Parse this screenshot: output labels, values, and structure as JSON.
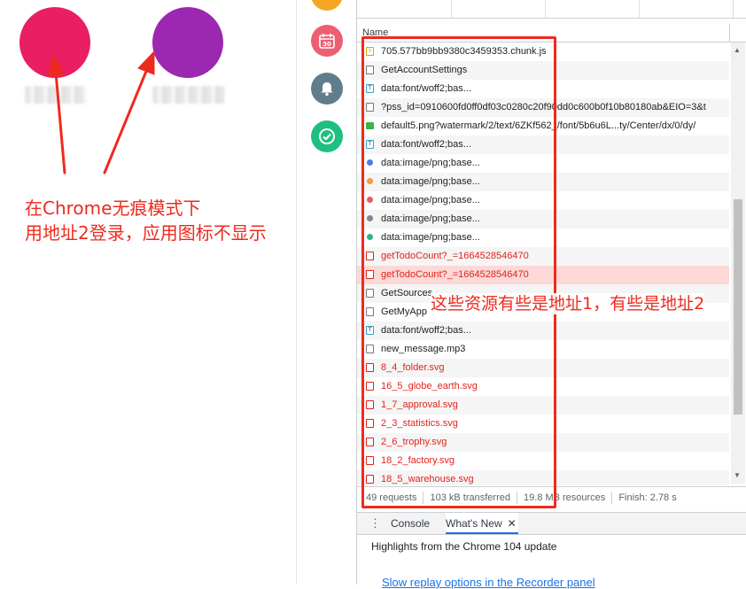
{
  "left": {
    "avatars": [
      {
        "color": "#e91e63"
      },
      {
        "color": "#9c27b0"
      }
    ],
    "annotation_lines": [
      "在Chrome无痕模式下",
      "用地址2登录，应用图标不显示"
    ]
  },
  "app_icons": [
    {
      "name": "top-icon",
      "color": "#f5a623",
      "glyph": ""
    },
    {
      "name": "calendar-icon",
      "color": "#ec5f73",
      "glyph": "30"
    },
    {
      "name": "bell-icon",
      "color": "#607d8b",
      "glyph": ""
    },
    {
      "name": "check-icon",
      "color": "#1fbf7f",
      "glyph": ""
    }
  ],
  "devtools": {
    "column_header": "Name",
    "requests": [
      {
        "name": "705.577bb9bb9380c3459353.chunk.js",
        "icon": "js",
        "error": false
      },
      {
        "name": "GetAccountSettings",
        "icon": "doc",
        "error": false
      },
      {
        "name": "data:font/woff2;bas...",
        "icon": "font",
        "error": false
      },
      {
        "name": "?pss_id=0910600fd0ff0df03c0280c20f90dd0c600b0f10b80180ab&EIO=3&t",
        "icon": "doc",
        "error": false
      },
      {
        "name": "default5.png?watermark/2/text/6ZKf562_/font/5b6u6L...ty/Center/dx/0/dy/",
        "icon": "img-green",
        "error": false
      },
      {
        "name": "data:font/woff2;bas...",
        "icon": "font",
        "error": false
      },
      {
        "name": "data:image/png;base...",
        "icon": "dot blue",
        "error": false
      },
      {
        "name": "data:image/png;base...",
        "icon": "dot orange",
        "error": false
      },
      {
        "name": "data:image/png;base...",
        "icon": "dot red",
        "error": false
      },
      {
        "name": "data:image/png;base...",
        "icon": "dot gray",
        "error": false
      },
      {
        "name": "data:image/png;base...",
        "icon": "dot green",
        "error": false
      },
      {
        "name": "getTodoCount?_=1664528546470",
        "icon": "err",
        "error": true
      },
      {
        "name": "getTodoCount?_=1664528546470",
        "icon": "err",
        "error": true,
        "selected": true
      },
      {
        "name": "GetSources",
        "icon": "doc",
        "error": false
      },
      {
        "name": "GetMyApp",
        "icon": "doc",
        "error": false
      },
      {
        "name": "data:font/woff2;bas...",
        "icon": "font",
        "error": false
      },
      {
        "name": "new_message.mp3",
        "icon": "doc",
        "error": false
      },
      {
        "name": "8_4_folder.svg",
        "icon": "err",
        "error": true
      },
      {
        "name": "16_5_globe_earth.svg",
        "icon": "err",
        "error": true
      },
      {
        "name": "1_7_approval.svg",
        "icon": "err",
        "error": true
      },
      {
        "name": "2_3_statistics.svg",
        "icon": "err",
        "error": true
      },
      {
        "name": "2_6_trophy.svg",
        "icon": "err",
        "error": true
      },
      {
        "name": "18_2_factory.svg",
        "icon": "err",
        "error": true
      },
      {
        "name": "18_5_warehouse.svg",
        "icon": "err",
        "error": true
      }
    ],
    "status": {
      "requests": "49 requests",
      "transferred": "103 kB transferred",
      "resources": "19.8 MB resources",
      "finish": "Finish: 2.78 s"
    },
    "drawer": {
      "tabs": [
        "Console",
        "What's New"
      ],
      "active_tab": "What's New",
      "highlight": "Highlights from the Chrome 104 update",
      "link": "Slow replay options in the Recorder panel"
    },
    "annotation": "这些资源有些是地址1，有些是地址2"
  },
  "colors": {
    "annotation_red": "#ee2a1f",
    "error_text": "#e0231d",
    "selected_row": "#fcd9d7"
  }
}
